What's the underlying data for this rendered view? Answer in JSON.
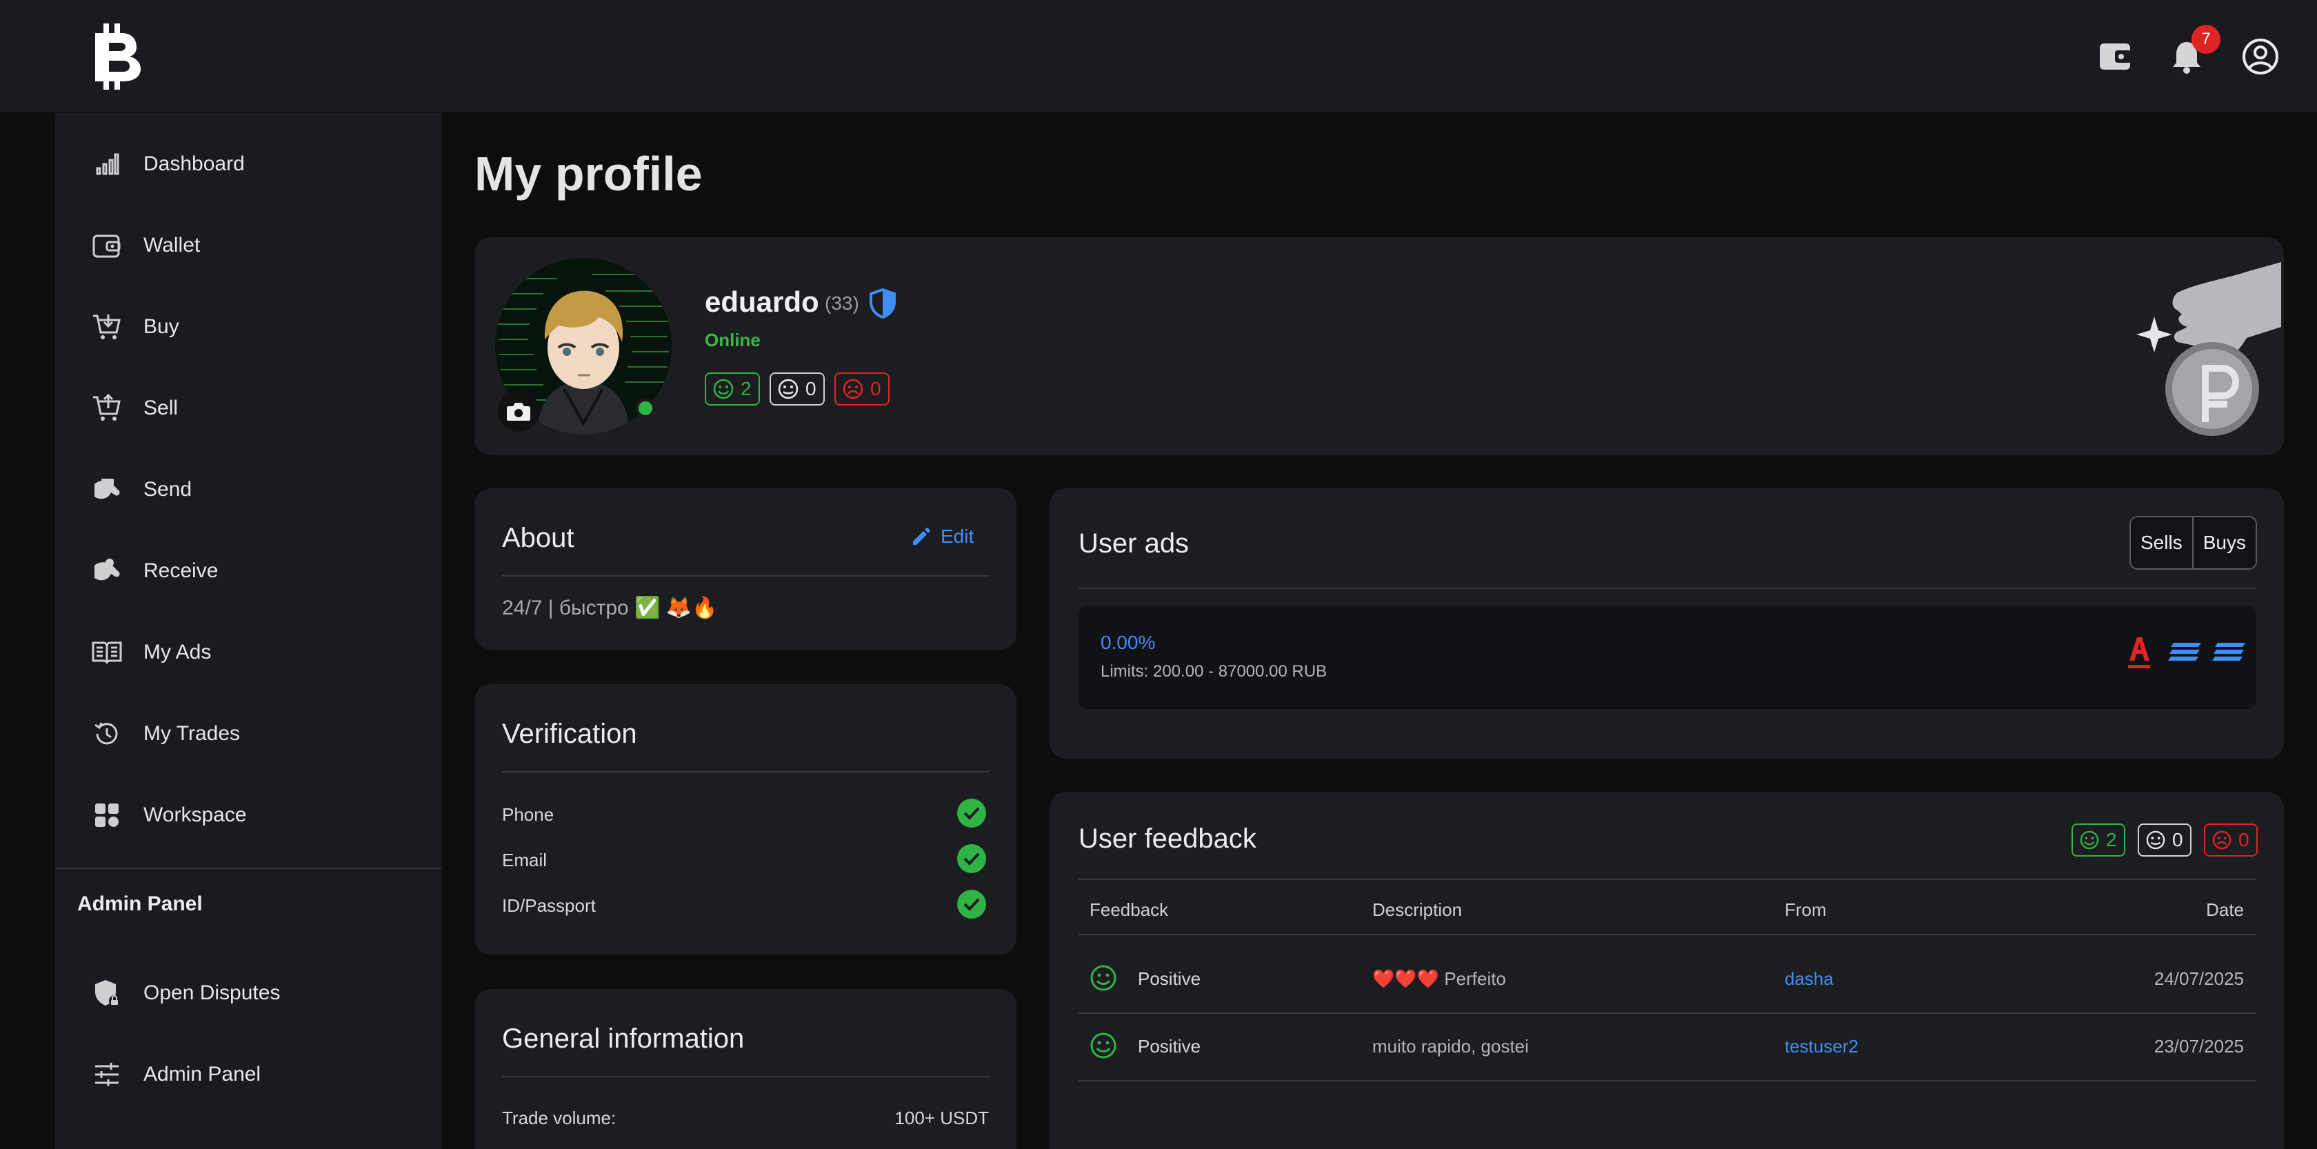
{
  "header": {
    "logo_alt": "Bitcoin-style B logo",
    "icons": [
      "wallet-icon",
      "bell-icon",
      "user-circle-icon"
    ],
    "notification_count": "7"
  },
  "sidebar": {
    "items": [
      {
        "label": "Dashboard",
        "icon": "bar-chart-icon"
      },
      {
        "label": "Wallet",
        "icon": "wallet-icon"
      },
      {
        "label": "Buy",
        "icon": "cart-in-icon"
      },
      {
        "label": "Sell",
        "icon": "cart-out-icon"
      },
      {
        "label": "Send",
        "icon": "send-money-icon"
      },
      {
        "label": "Receive",
        "icon": "receive-money-icon"
      },
      {
        "label": "My Ads",
        "icon": "book-icon"
      },
      {
        "label": "My Trades",
        "icon": "history-icon"
      },
      {
        "label": "Workspace",
        "icon": "grid-icon"
      }
    ],
    "admin_heading": "Admin Panel",
    "admin_items": [
      {
        "label": "Open Disputes",
        "icon": "shield-lock-icon"
      },
      {
        "label": "Admin Panel",
        "icon": "sliders-icon"
      }
    ]
  },
  "page": {
    "title": "My profile"
  },
  "profile": {
    "username": "eduardo",
    "count": "(33)",
    "status": "Online",
    "ratings": {
      "positive": "2",
      "neutral": "0",
      "negative": "0"
    }
  },
  "about": {
    "title": "About",
    "edit_label": "Edit",
    "text": "24/7 | быстро ✅ 🦊🔥"
  },
  "verification": {
    "title": "Verification",
    "items": [
      "Phone",
      "Email",
      "ID/Passport"
    ]
  },
  "general": {
    "title": "General information",
    "rows": [
      {
        "label": "Trade volume:",
        "value": "100+ USDT"
      }
    ]
  },
  "user_ads": {
    "title": "User ads",
    "tabs": [
      "Sells",
      "Buys"
    ],
    "ads": [
      {
        "rate": "0.00%",
        "limits": "Limits: 200.00 - 87000.00 RUB"
      }
    ],
    "accent": "#3f8ef6"
  },
  "user_feedback": {
    "title": "User feedback",
    "ratings": {
      "positive": "2",
      "neutral": "0",
      "negative": "0"
    },
    "columns": [
      "Feedback",
      "Description",
      "From",
      "Date"
    ],
    "rows": [
      {
        "feedback": "Positive",
        "description": "❤️❤️❤️ Perfeito",
        "from": "dasha",
        "date": "24/07/2025"
      },
      {
        "feedback": "Positive",
        "description": "muito rapido, gostei",
        "from": "testuser2",
        "date": "23/07/2025"
      }
    ]
  },
  "colors": {
    "positive": "#2fb344",
    "negative": "#e02424",
    "link": "#3f8ef6"
  }
}
